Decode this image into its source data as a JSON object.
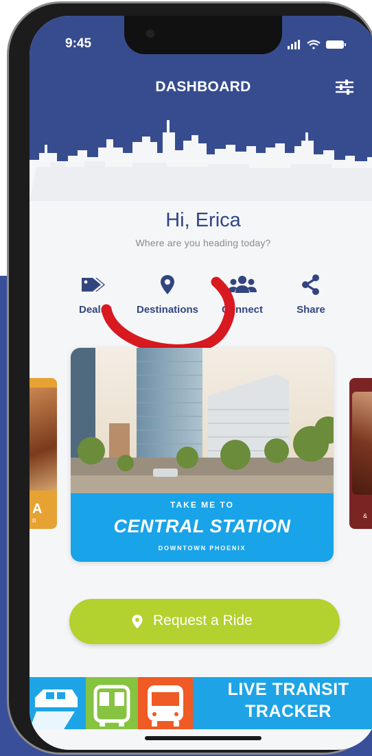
{
  "status_bar": {
    "time": "9:45"
  },
  "header": {
    "title": "DASHBOARD"
  },
  "greeting": {
    "title": "Hi, Erica",
    "subtitle": "Where are you heading today?"
  },
  "actions": [
    {
      "label": "Deals",
      "icon": "tag-icon"
    },
    {
      "label": "Destinations",
      "icon": "map-pin-icon"
    },
    {
      "label": "Connect",
      "icon": "users-icon"
    },
    {
      "label": "Share",
      "icon": "share-icon"
    }
  ],
  "side_cards": {
    "left_title": "A",
    "left_sub": "R",
    "right_sub": "&"
  },
  "feature": {
    "eyebrow": "TAKE ME TO",
    "title": "CENTRAL STATION",
    "subtitle": "DOWNTOWN PHOENIX"
  },
  "ride_button": {
    "label": "Request a Ride"
  },
  "transit_banner": {
    "line1": "LIVE TRANSIT",
    "line2": "TRACKER"
  },
  "colors": {
    "brand_blue": "#364c8f",
    "accent_green": "#b3d12f",
    "sky_blue": "#1ea4e6",
    "annotation_red": "#d81920"
  }
}
